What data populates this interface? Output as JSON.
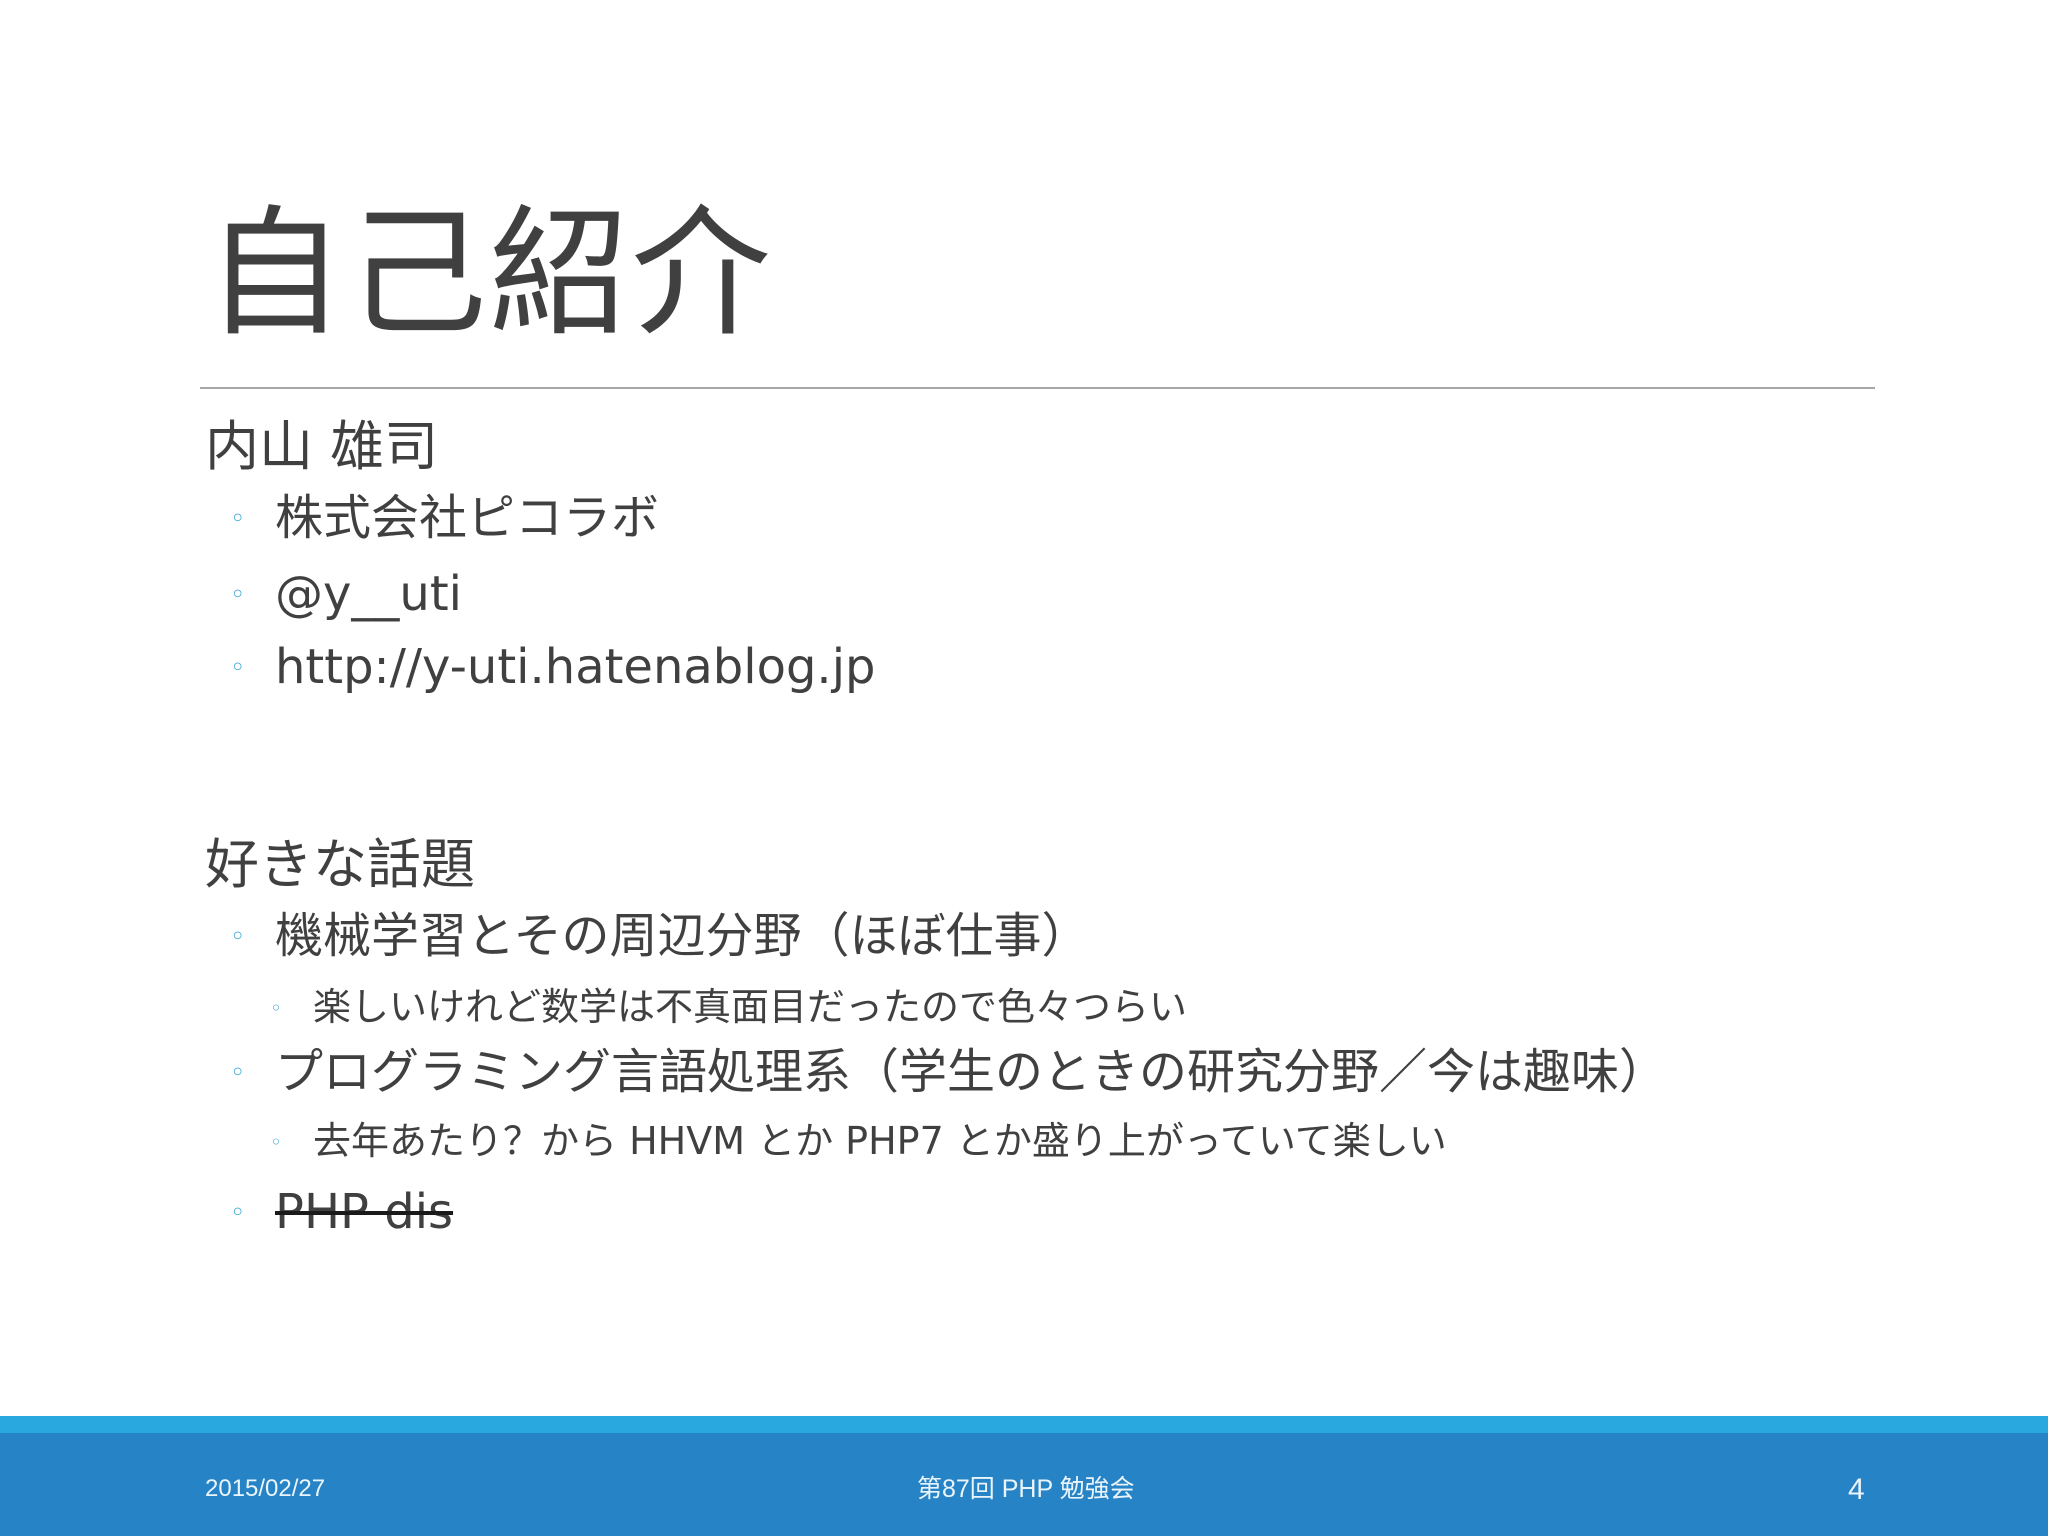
{
  "slide": {
    "title": "自己紹介",
    "profile": {
      "name": "内山 雄司",
      "items": [
        "株式会社ピコラボ",
        "@y__uti",
        "http://y-uti.hatenablog.jp"
      ]
    },
    "topics": {
      "heading": "好きな話題",
      "item1": "機械学習とその周辺分野（ほぼ仕事）",
      "item1_sub": "楽しいけれど数学は不真面目だったので色々つらい",
      "item2": "プログラミング言語処理系（学生のときの研究分野／今は趣味）",
      "item2_sub": "去年あたり？から HHVM とか PHP7 とか盛り上がっていて楽しい",
      "item3_struck": "PHP dis"
    },
    "bullet_marker": "◦"
  },
  "footer": {
    "date": "2015/02/27",
    "event": "第87回 PHP 勉強会",
    "page": "4"
  },
  "colors": {
    "text": "#404040",
    "bullet_accent": "#3aa6d6",
    "footer_bar": "#2683c6",
    "footer_stripe": "#29a8e0"
  }
}
